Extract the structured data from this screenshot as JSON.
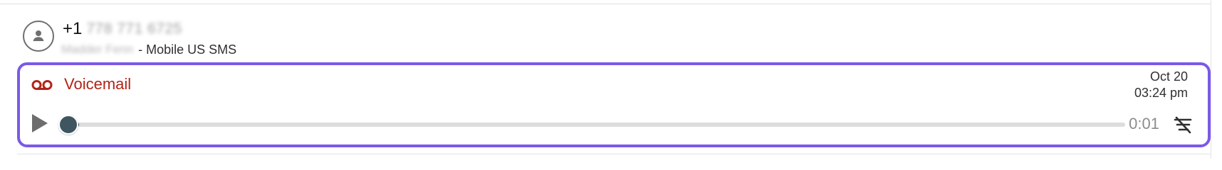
{
  "contact": {
    "phone_prefix": "+1",
    "phone_number_redacted": "778 771 6725",
    "name_redacted": "Madder Fenn",
    "line_suffix": "- Mobile US SMS",
    "avatar_icon": "person-icon"
  },
  "voicemail": {
    "icon": "voicemail-icon",
    "title": "Voicemail",
    "date": "Oct 20",
    "time": "03:24 pm",
    "duration": "0:01",
    "progress": 0.01,
    "play_icon": "play-icon",
    "transcript_icon": "transcript-off-icon",
    "accent_color": "#7b59e8",
    "title_color": "#b12417"
  }
}
